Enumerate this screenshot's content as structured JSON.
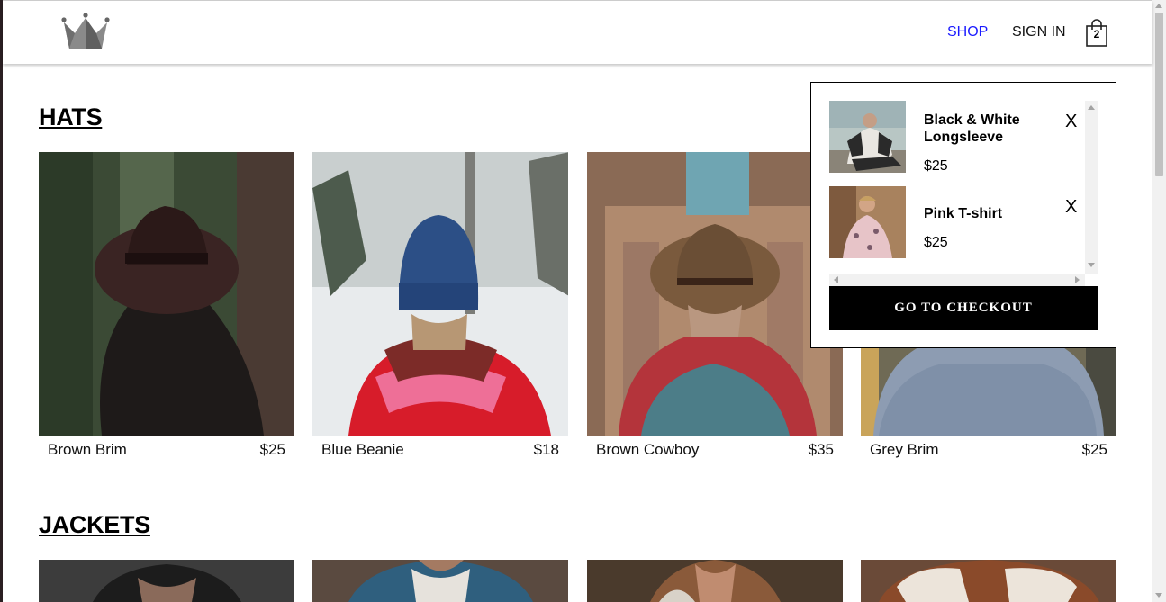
{
  "header": {
    "logo": "crown-logo",
    "nav": {
      "shop_label": "SHOP",
      "signin_label": "SIGN IN"
    },
    "cart": {
      "icon": "shopping-bag-icon",
      "count": "2"
    }
  },
  "sections": [
    {
      "title": "HATS",
      "items": [
        {
          "name": "Brown Brim",
          "price": "$25"
        },
        {
          "name": "Blue Beanie",
          "price": "$18"
        },
        {
          "name": "Brown Cowboy",
          "price": "$35"
        },
        {
          "name": "Grey Brim",
          "price": "$25"
        }
      ]
    },
    {
      "title": "JACKETS",
      "items": []
    }
  ],
  "cart_dropdown": {
    "items": [
      {
        "name": "Black & White Longsleeve",
        "price": "$25",
        "remove_label": "X"
      },
      {
        "name": "Pink T-shirt",
        "price": "$25",
        "remove_label": "X"
      }
    ],
    "checkout_label": "GO TO CHECKOUT"
  },
  "colors": {
    "nav_active": "#1a1aff",
    "button_bg": "#000000"
  }
}
